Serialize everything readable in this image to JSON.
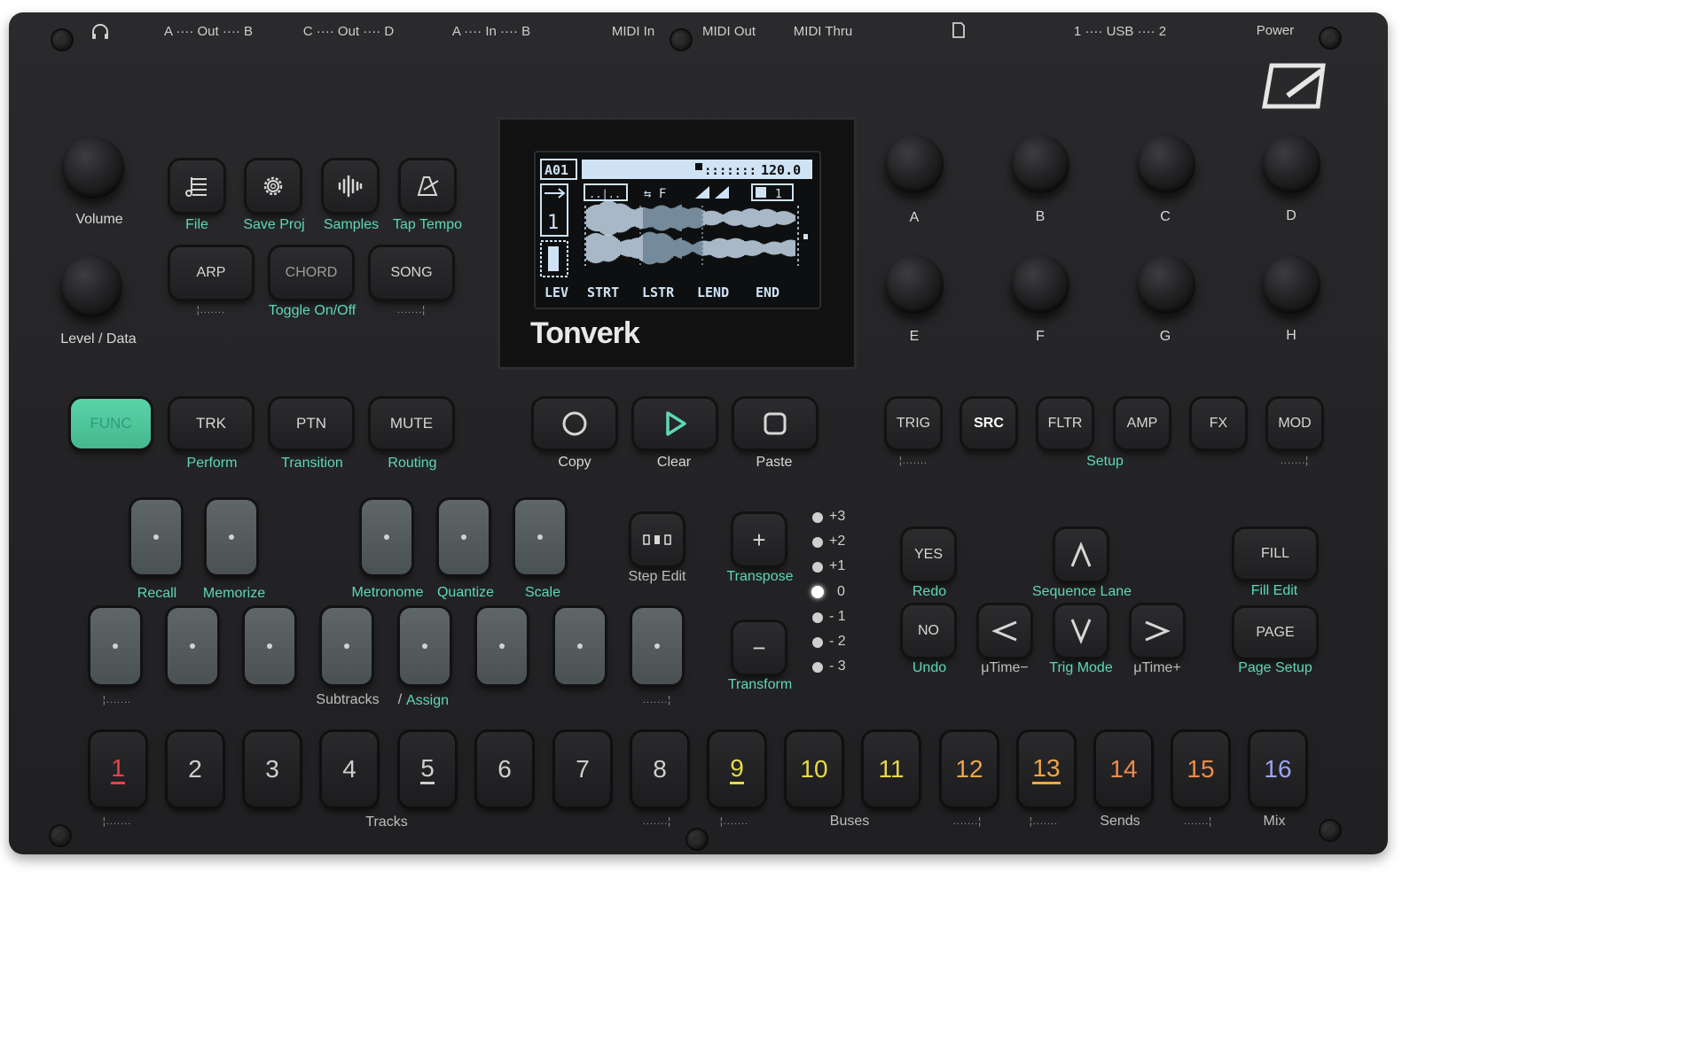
{
  "top_labels": {
    "out_ab": "A ···· Out ···· B",
    "out_cd": "C ···· Out ···· D",
    "in_ab": "A ····  In  ···· B",
    "midi_in": "MIDI In",
    "midi_out": "MIDI Out",
    "midi_thru": "MIDI Thru",
    "usb": "1 ···· USB ···· 2",
    "power": "Power"
  },
  "left_knobs": {
    "volume": "Volume",
    "level": "Level / Data"
  },
  "top_buttons": {
    "file": "File",
    "save": "Save Proj",
    "samples": "Samples",
    "tap": "Tap Tempo",
    "arp": "ARP",
    "chord": "CHORD",
    "song": "SONG",
    "toggle": "Toggle On/Off"
  },
  "screen": {
    "brand": "Tonverk",
    "pattern": "A01",
    "tempo": "120.0",
    "track": "1",
    "params": [
      "LEV",
      "STRT",
      "LSTR",
      "LEND",
      "END"
    ]
  },
  "right_knobs": [
    "A",
    "B",
    "C",
    "D",
    "E",
    "F",
    "G",
    "H"
  ],
  "mid_row": {
    "func": "FUNC",
    "trk": "TRK",
    "trk_sub": "Perform",
    "ptn": "PTN",
    "ptn_sub": "Transition",
    "mute": "MUTE",
    "mute_sub": "Routing",
    "copy": "Copy",
    "clear": "Clear",
    "paste": "Paste"
  },
  "page_buttons": {
    "trig": "TRIG",
    "src": "SRC",
    "fltr": "FLTR",
    "amp": "AMP",
    "fx": "FX",
    "mod": "MOD",
    "setup": "Setup"
  },
  "pad_labels": {
    "recall": "Recall",
    "memorize": "Memorize",
    "metronome": "Metronome",
    "quantize": "Quantize",
    "scale": "Scale",
    "subtracks": "Subtracks",
    "slash": "/",
    "assign": "Assign"
  },
  "edit": {
    "step_edit": "Step Edit",
    "transpose": "Transpose",
    "transform": "Transform",
    "plus": "+",
    "minus": "−",
    "scale_dots": [
      "+3",
      "+2",
      "+1",
      "0",
      "- 1",
      "- 2",
      "- 3"
    ]
  },
  "nav": {
    "yes": "YES",
    "redo": "Redo",
    "no": "NO",
    "undo": "Undo",
    "seq_lane": "Sequence Lane",
    "utime_minus": "μTime−",
    "trig_mode": "Trig Mode",
    "utime_plus": "μTime+",
    "fill": "FILL",
    "fill_edit": "Fill Edit",
    "page": "PAGE",
    "page_setup": "Page Setup"
  },
  "steps": [
    "1",
    "2",
    "3",
    "4",
    "5",
    "6",
    "7",
    "8",
    "9",
    "10",
    "11",
    "12",
    "13",
    "14",
    "15",
    "16"
  ],
  "bottom_labels": {
    "tracks": "Tracks",
    "buses": "Buses",
    "sends": "Sends",
    "mix": "Mix"
  },
  "colors": {
    "accent": "#5ed8b2",
    "step_colors": [
      "#e8424d",
      "#cfcfcf",
      "#cfcfcf",
      "#cfcfcf",
      "#cfcfcf",
      "#cfcfcf",
      "#cfcfcf",
      "#cfcfcf",
      "#e6d94a",
      "#e6d94a",
      "#e6d94a",
      "#f0a64a",
      "#f0a64a",
      "#f08a4a",
      "#f08a4a",
      "#9aa6f2"
    ]
  }
}
